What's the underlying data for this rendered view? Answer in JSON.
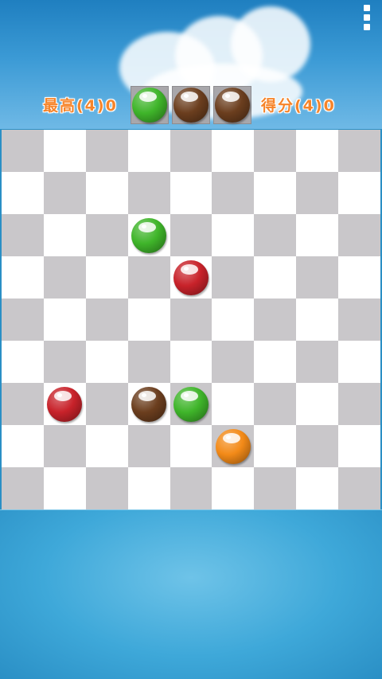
{
  "header": {
    "best_label": "最高(4)0",
    "score_label": "得分(4)0",
    "next_balls": [
      "green",
      "brown",
      "brown"
    ]
  },
  "board": {
    "rows": 9,
    "cols": 9,
    "balls": [
      {
        "row": 2,
        "col": 3,
        "color": "green"
      },
      {
        "row": 3,
        "col": 4,
        "color": "red"
      },
      {
        "row": 6,
        "col": 1,
        "color": "red"
      },
      {
        "row": 6,
        "col": 3,
        "color": "brown"
      },
      {
        "row": 6,
        "col": 4,
        "color": "green"
      },
      {
        "row": 7,
        "col": 5,
        "color": "orange"
      }
    ]
  },
  "colors": {
    "green": "#3fb52a",
    "red": "#c8222a",
    "brown": "#6b3e1e",
    "orange": "#f38a18",
    "score_text": "#f6842a",
    "cell_dark": "#c9c7ca",
    "cell_light": "#ffffff"
  },
  "icons": {
    "menu": "vertical-dots-icon"
  }
}
